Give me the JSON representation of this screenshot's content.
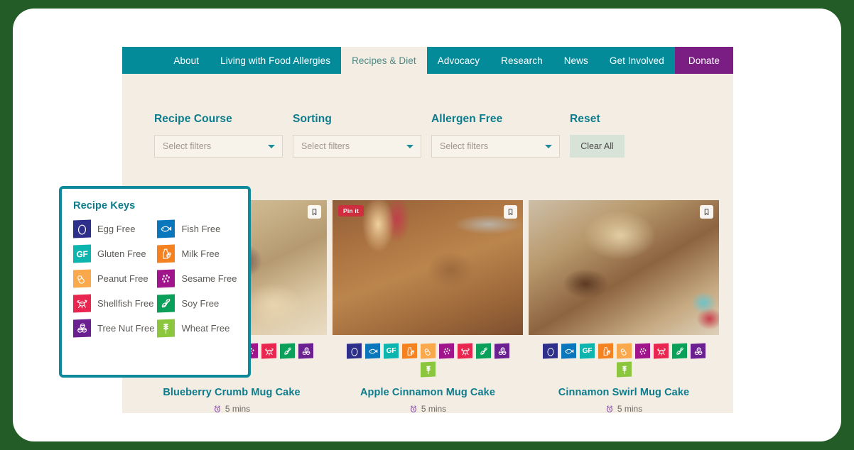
{
  "theme": {
    "outer_background": "#245c28",
    "frame_background": "#ffffff",
    "panel_background": "#f4ede3",
    "nav_background": "#048b9a",
    "nav_active_text": "#4c8a86",
    "donate_background": "#7b1e83",
    "teal_accent": "#0c7c8c",
    "keys_border": "#0c8a9b",
    "clear_button_background": "#d8e3d7"
  },
  "nav": {
    "items": [
      {
        "label": "About",
        "active": false,
        "style": "normal"
      },
      {
        "label": "Living with Food Allergies",
        "active": false,
        "style": "normal"
      },
      {
        "label": "Recipes & Diet",
        "active": true,
        "style": "normal"
      },
      {
        "label": "Advocacy",
        "active": false,
        "style": "normal"
      },
      {
        "label": "Research",
        "active": false,
        "style": "normal"
      },
      {
        "label": "News",
        "active": false,
        "style": "normal"
      },
      {
        "label": "Get Involved",
        "active": false,
        "style": "normal"
      },
      {
        "label": "Donate",
        "active": false,
        "style": "donate"
      }
    ]
  },
  "filters": {
    "groups": [
      {
        "label": "Recipe Course",
        "value": "",
        "placeholder": "Select filters",
        "icon": "chevron-down-icon"
      },
      {
        "label": "Sorting",
        "value": "",
        "placeholder": "Select filters",
        "icon": "chevron-down-icon"
      },
      {
        "label": "Allergen Free",
        "value": "",
        "placeholder": "Select filters",
        "icon": "chevron-down-icon"
      }
    ],
    "reset": {
      "label": "Reset",
      "button_label": "Clear All"
    }
  },
  "recipe_keys": {
    "title": "Recipe Keys",
    "items": [
      {
        "label": "Egg Free",
        "icon": "egg-icon",
        "color": "#2d2f8a"
      },
      {
        "label": "Fish Free",
        "icon": "fish-icon",
        "color": "#0a77bd"
      },
      {
        "label": "Gluten Free",
        "icon": "gf-icon",
        "color": "#0cb5ad"
      },
      {
        "label": "Milk Free",
        "icon": "milk-icon",
        "color": "#f58220"
      },
      {
        "label": "Peanut Free",
        "icon": "peanut-icon",
        "color": "#f9a94b"
      },
      {
        "label": "Sesame Free",
        "icon": "sesame-icon",
        "color": "#a0148c"
      },
      {
        "label": "Shellfish Free",
        "icon": "shellfish-icon",
        "color": "#e8264f"
      },
      {
        "label": "Soy Free",
        "icon": "soy-icon",
        "color": "#0aa05a"
      },
      {
        "label": "Tree Nut Free",
        "icon": "treenut-icon",
        "color": "#6b2091"
      },
      {
        "label": "Wheat Free",
        "icon": "wheat-icon",
        "color": "#8cc63f"
      }
    ]
  },
  "cards": [
    {
      "title": "Blueberry Crumb Mug Cake",
      "time": "5 mins",
      "time_icon": "timer-icon",
      "photo_class": "photo-1",
      "pin_badge": null,
      "bookmark_icon": "bookmark-icon",
      "badges": [
        {
          "icon": "egg-icon",
          "color": "#2d2f8a",
          "label": "Egg Free"
        },
        {
          "icon": "fish-icon",
          "color": "#0a77bd",
          "label": "Fish Free"
        },
        {
          "icon": "gf-icon",
          "color": "#0cb5ad",
          "label": "Gluten Free"
        },
        {
          "icon": "milk-icon",
          "color": "#f58220",
          "label": "Milk Free"
        },
        {
          "icon": "peanut-icon",
          "color": "#f9a94b",
          "label": "Peanut Free"
        },
        {
          "icon": "sesame-icon",
          "color": "#a0148c",
          "label": "Sesame Free"
        },
        {
          "icon": "shellfish-icon",
          "color": "#e8264f",
          "label": "Shellfish Free"
        },
        {
          "icon": "soy-icon",
          "color": "#0aa05a",
          "label": "Soy Free"
        },
        {
          "icon": "treenut-icon",
          "color": "#6b2091",
          "label": "Tree Nut Free"
        },
        {
          "icon": "wheat-icon",
          "color": "#8cc63f",
          "label": "Wheat Free"
        }
      ]
    },
    {
      "title": "Apple Cinnamon Mug Cake",
      "time": "5 mins",
      "time_icon": "timer-icon",
      "photo_class": "photo-2",
      "pin_badge": "Pin it",
      "bookmark_icon": "bookmark-icon",
      "badges": [
        {
          "icon": "egg-icon",
          "color": "#2d2f8a",
          "label": "Egg Free"
        },
        {
          "icon": "fish-icon",
          "color": "#0a77bd",
          "label": "Fish Free"
        },
        {
          "icon": "gf-icon",
          "color": "#0cb5ad",
          "label": "Gluten Free"
        },
        {
          "icon": "milk-icon",
          "color": "#f58220",
          "label": "Milk Free"
        },
        {
          "icon": "peanut-icon",
          "color": "#f9a94b",
          "label": "Peanut Free"
        },
        {
          "icon": "sesame-icon",
          "color": "#a0148c",
          "label": "Sesame Free"
        },
        {
          "icon": "shellfish-icon",
          "color": "#e8264f",
          "label": "Shellfish Free"
        },
        {
          "icon": "soy-icon",
          "color": "#0aa05a",
          "label": "Soy Free"
        },
        {
          "icon": "treenut-icon",
          "color": "#6b2091",
          "label": "Tree Nut Free"
        },
        {
          "icon": "wheat-icon",
          "color": "#8cc63f",
          "label": "Wheat Free"
        }
      ]
    },
    {
      "title": "Cinnamon Swirl Mug Cake",
      "time": "5 mins",
      "time_icon": "timer-icon",
      "photo_class": "photo-3",
      "pin_badge": null,
      "bookmark_icon": "bookmark-icon",
      "badges": [
        {
          "icon": "egg-icon",
          "color": "#2d2f8a",
          "label": "Egg Free"
        },
        {
          "icon": "fish-icon",
          "color": "#0a77bd",
          "label": "Fish Free"
        },
        {
          "icon": "gf-icon",
          "color": "#0cb5ad",
          "label": "Gluten Free"
        },
        {
          "icon": "milk-icon",
          "color": "#f58220",
          "label": "Milk Free"
        },
        {
          "icon": "peanut-icon",
          "color": "#f9a94b",
          "label": "Peanut Free"
        },
        {
          "icon": "sesame-icon",
          "color": "#a0148c",
          "label": "Sesame Free"
        },
        {
          "icon": "shellfish-icon",
          "color": "#e8264f",
          "label": "Shellfish Free"
        },
        {
          "icon": "soy-icon",
          "color": "#0aa05a",
          "label": "Soy Free"
        },
        {
          "icon": "treenut-icon",
          "color": "#6b2091",
          "label": "Tree Nut Free"
        },
        {
          "icon": "wheat-icon",
          "color": "#8cc63f",
          "label": "Wheat Free"
        }
      ]
    }
  ]
}
